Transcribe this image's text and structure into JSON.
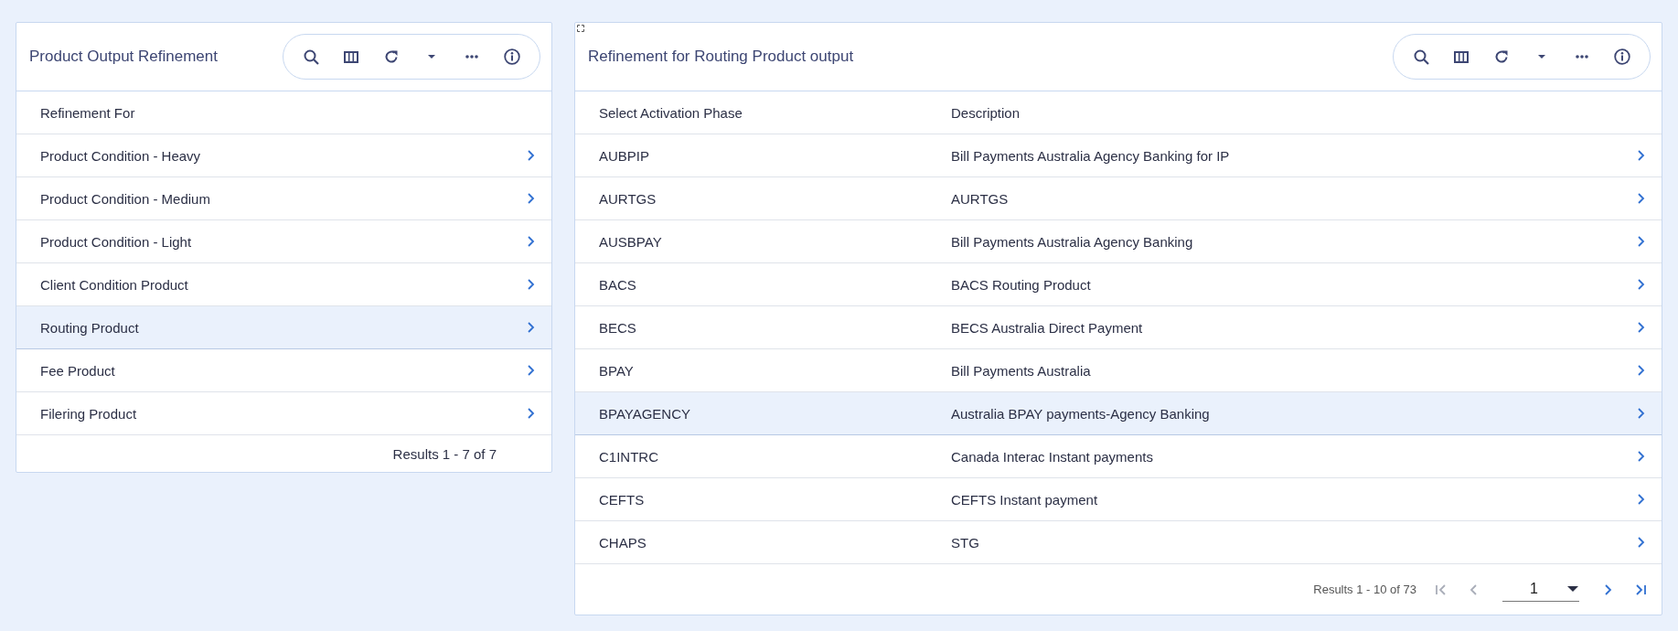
{
  "left_panel": {
    "title": "Product Output Refinement",
    "columns": [
      "Refinement For"
    ],
    "rows": [
      {
        "cells": [
          "Product Condition - Heavy"
        ],
        "selected": false
      },
      {
        "cells": [
          "Product Condition - Medium"
        ],
        "selected": false
      },
      {
        "cells": [
          "Product Condition - Light"
        ],
        "selected": false
      },
      {
        "cells": [
          "Client Condition Product"
        ],
        "selected": false
      },
      {
        "cells": [
          "Routing Product"
        ],
        "selected": true
      },
      {
        "cells": [
          "Fee Product"
        ],
        "selected": false
      },
      {
        "cells": [
          "Filering Product"
        ],
        "selected": false
      }
    ],
    "footer": {
      "results": "Results 1 - 7 of 7"
    }
  },
  "right_panel": {
    "title": "Refinement for Routing Product output",
    "columns": [
      "Select Activation Phase",
      "Description"
    ],
    "rows": [
      {
        "cells": [
          "AUBPIP",
          "Bill Payments Australia Agency Banking for IP"
        ],
        "selected": false
      },
      {
        "cells": [
          "AURTGS",
          "AURTGS"
        ],
        "selected": false
      },
      {
        "cells": [
          "AUSBPAY",
          "Bill Payments Australia Agency Banking"
        ],
        "selected": false
      },
      {
        "cells": [
          "BACS",
          "BACS Routing Product"
        ],
        "selected": false
      },
      {
        "cells": [
          "BECS",
          "BECS Australia Direct Payment"
        ],
        "selected": false
      },
      {
        "cells": [
          "BPAY",
          "Bill Payments Australia"
        ],
        "selected": false
      },
      {
        "cells": [
          "BPAYAGENCY",
          "Australia BPAY payments-Agency Banking"
        ],
        "selected": true
      },
      {
        "cells": [
          "C1INTRC",
          "Canada Interac Instant payments"
        ],
        "selected": false
      },
      {
        "cells": [
          "CEFTS",
          "CEFTS Instant payment"
        ],
        "selected": false
      },
      {
        "cells": [
          "CHAPS",
          "STG"
        ],
        "selected": false
      }
    ],
    "footer": {
      "results": "Results 1 - 10 of 73",
      "page": "1",
      "pager": [
        {
          "kind": "first",
          "disabled": true
        },
        {
          "kind": "prev",
          "disabled": true
        },
        {
          "kind": "next",
          "disabled": false
        },
        {
          "kind": "last",
          "disabled": false
        }
      ]
    }
  }
}
